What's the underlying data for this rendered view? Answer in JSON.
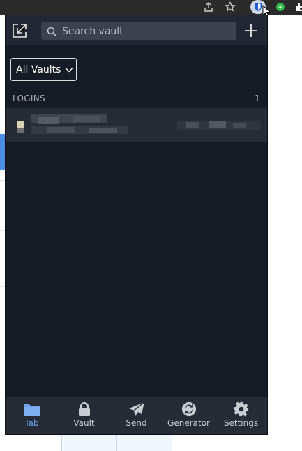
{
  "search": {
    "placeholder": "Search vault"
  },
  "vault_filter": {
    "selected": "All Vaults"
  },
  "section": {
    "title": "LOGINS",
    "count": "1"
  },
  "nav": {
    "items": [
      {
        "label": "Tab",
        "icon": "folder-icon",
        "active": true
      },
      {
        "label": "Vault",
        "icon": "lock-icon",
        "active": false
      },
      {
        "label": "Send",
        "icon": "paper-plane-icon",
        "active": false
      },
      {
        "label": "Generator",
        "icon": "refresh-icon",
        "active": false
      },
      {
        "label": "Settings",
        "icon": "gear-icon",
        "active": false
      }
    ]
  },
  "colors": {
    "popup_bg": "#161c26",
    "header_bg": "#222733",
    "accent": "#6fa3ee",
    "nav_bg": "#262b36"
  }
}
